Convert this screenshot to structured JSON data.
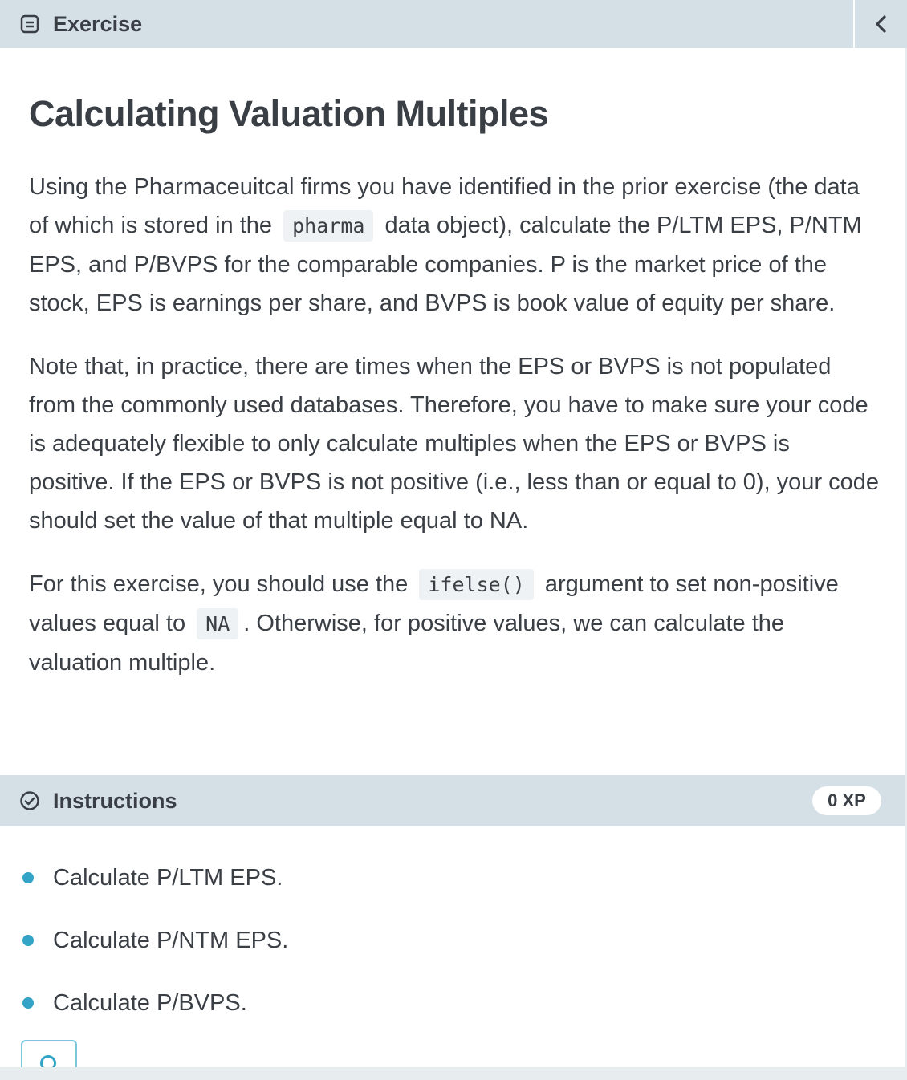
{
  "header": {
    "icon": "exercise-icon",
    "title": "Exercise",
    "collapse_icon": "chevron-left-icon"
  },
  "exercise": {
    "heading": "Calculating Valuation Multiples",
    "paragraph1": {
      "before_code": "Using the Pharmaceuitcal firms you have identified in the prior exercise (the data of which is stored in the",
      "code": "pharma",
      "after_code": "data object), calculate the P/LTM EPS, P/NTM EPS, and P/BVPS for the comparable companies. P is the market price of the stock, EPS is earnings per share, and BVPS is book value of equity per share."
    },
    "paragraph2": "Note that, in practice, there are times when the EPS or BVPS is not populated from the commonly used databases. Therefore, you have to make sure your code is adequately flexible to only calculate multiples when the EPS or BVPS is positive. If the EPS or BVPS is not positive (i.e., less than or equal to 0), your code should set the value of that multiple equal to NA.",
    "paragraph3": {
      "part1": "For this exercise, you should use the",
      "code1": "ifelse()",
      "part2": "argument to set non-positive values equal to",
      "code2": "NA",
      "part3": ". Otherwise, for positive values, we can calculate the valuation multiple."
    }
  },
  "instructions": {
    "icon": "check-circle-icon",
    "label": "Instructions",
    "xp": "0 XP",
    "items": [
      "Calculate P/LTM EPS.",
      "Calculate P/NTM EPS.",
      "Calculate P/BVPS."
    ]
  },
  "colors": {
    "header_bg": "#d4dfe6",
    "bullet": "#33a4c6",
    "text": "#3a3f45",
    "code_bg": "#eef2f4"
  }
}
